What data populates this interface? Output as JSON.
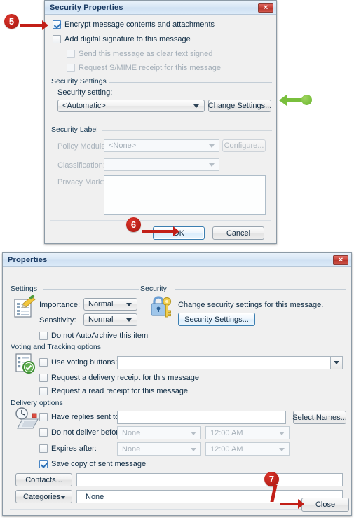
{
  "security_dialog": {
    "title": "Security Properties",
    "close_icon": "close-icon",
    "checkboxes": {
      "encrypt": "Encrypt message contents and attachments",
      "add_signature": "Add digital signature to this message",
      "clear_text": "Send this message as clear text signed",
      "smime_receipt": "Request S/MIME receipt for this message"
    },
    "security_settings_group": "Security Settings",
    "security_setting_label": "Security setting:",
    "security_setting_value": "<Automatic>",
    "change_settings_button": "Change Settings...",
    "security_label_group": "Security Label",
    "policy_module_label": "Policy Module:",
    "policy_module_value": "<None>",
    "configure_button": "Configure...",
    "classification_label": "Classification:",
    "classification_value": "",
    "privacy_mark_label": "Privacy Mark:",
    "privacy_mark_value": "",
    "ok_button": "OK",
    "cancel_button": "Cancel"
  },
  "properties_dialog": {
    "title": "Properties",
    "close_icon": "close-icon",
    "settings_group": "Settings",
    "settings_icon": "message-settings-icon",
    "importance_label": "Importance:",
    "importance_value": "Normal",
    "sensitivity_label": "Sensitivity:",
    "sensitivity_value": "Normal",
    "autoarchive_checkbox": "Do not AutoArchive this item",
    "security_group": "Security",
    "security_icon": "lock-key-icon",
    "security_description": "Change security settings for this message.",
    "security_settings_button": "Security Settings...",
    "voting_group": "Voting and Tracking options",
    "voting_icon": "voting-ballot-icon",
    "use_voting_checkbox": "Use voting buttons:",
    "use_voting_value": "",
    "delivery_receipt_checkbox": "Request a delivery receipt for this message",
    "read_receipt_checkbox": "Request a read receipt for this message",
    "delivery_group": "Delivery options",
    "delivery_icon": "clock-envelope-icon",
    "have_replies_checkbox": "Have replies sent to:",
    "have_replies_value": "",
    "select_names_button": "Select Names...",
    "do_not_deliver_checkbox": "Do not deliver before:",
    "do_not_deliver_date": "None",
    "do_not_deliver_time": "12:00 AM",
    "expires_after_checkbox": "Expires after:",
    "expires_after_date": "None",
    "expires_after_time": "12:00 AM",
    "save_copy_checkbox": "Save copy of sent message",
    "contacts_button": "Contacts...",
    "contacts_value": "",
    "categories_button": "Categories",
    "categories_value": "None",
    "close_button": "Close"
  },
  "callouts": {
    "step5": "5",
    "step6": "6",
    "step7": "7"
  },
  "colors": {
    "callout_red": "#b71f17",
    "arrow_green": "#79bf3c",
    "title_text": "#1b3b63",
    "dialog_bg": "#f0f0f0"
  }
}
